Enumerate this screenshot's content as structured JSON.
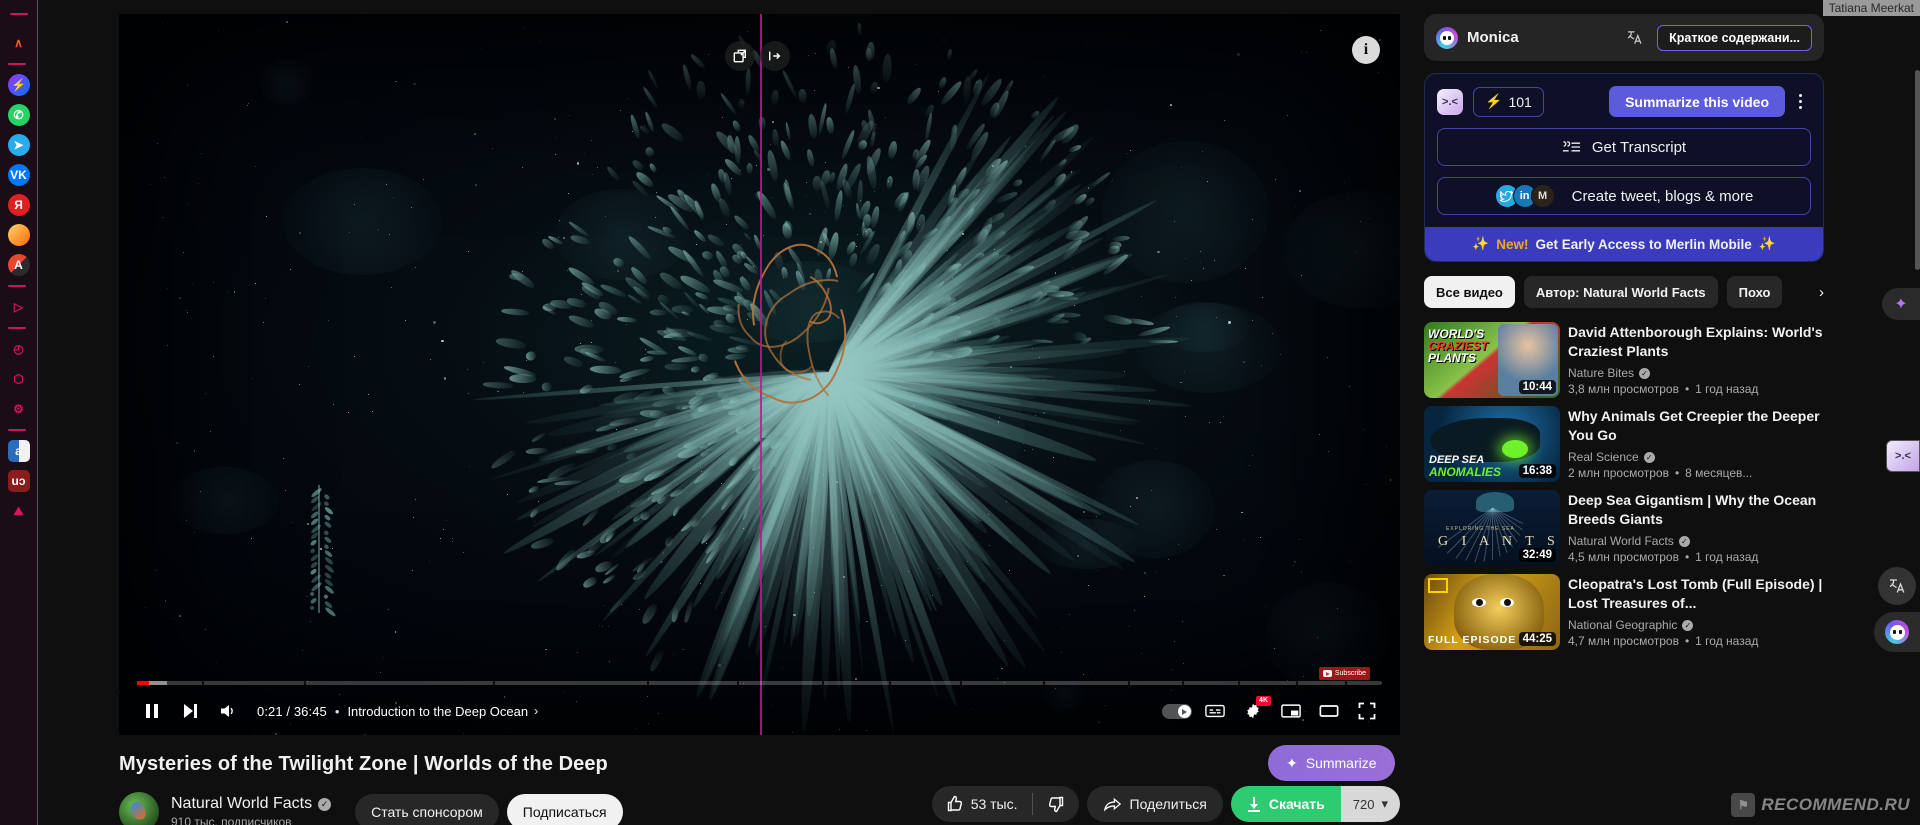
{
  "browser": {
    "tab_title": "Tatiana Meerkat",
    "left_rail_icons": [
      {
        "name": "brave-lion-icon",
        "glyph": "∧",
        "color": "#fb542b",
        "bg": "none"
      },
      {
        "name": "messenger-icon",
        "glyph": "",
        "color": "#fff",
        "bg": "linear-gradient(135deg,#a033ff,#0074f5)"
      },
      {
        "name": "whatsapp-icon",
        "glyph": "",
        "color": "#fff",
        "bg": "#25d366"
      },
      {
        "name": "telegram-icon",
        "glyph": "",
        "color": "#fff",
        "bg": "#2aabee"
      },
      {
        "name": "vk-icon",
        "glyph": "VK",
        "color": "#fff",
        "bg": "#0077ff"
      },
      {
        "name": "yandex-icon",
        "glyph": "Я",
        "color": "#fff",
        "bg": "#e02020"
      },
      {
        "name": "mail-icon",
        "glyph": "",
        "color": "#fff",
        "bg": "linear-gradient(135deg,#ffd26f,#ff6a00)"
      },
      {
        "name": "translate-app-icon",
        "glyph": "A",
        "color": "#fff",
        "bg": "linear-gradient(135deg,#e8452f 50%,#2b2b2b 50%)"
      },
      {
        "name": "video-player-icon",
        "glyph": "▷",
        "color": "#d6145f",
        "bg": "none"
      },
      {
        "name": "history-clock-icon",
        "glyph": "◴",
        "color": "#d6145f",
        "bg": "none"
      },
      {
        "name": "box-3d-icon",
        "glyph": "⬡",
        "color": "#d6145f",
        "bg": "none"
      },
      {
        "name": "settings-gear-icon",
        "glyph": "⚙",
        "color": "#d6145f",
        "bg": "none"
      },
      {
        "name": "amazon-assistant-icon",
        "glyph": "a",
        "color": "#fff",
        "bg": "linear-gradient(90deg,#2a6ebb 50%,#f1f1f1 50%)"
      },
      {
        "name": "ublock-shield-icon",
        "glyph": "uɔ",
        "color": "#fff",
        "bg": "#8a1c1c"
      },
      {
        "name": "image-tool-icon",
        "glyph": "⛰",
        "color": "#d6145f",
        "bg": "none"
      }
    ]
  },
  "player": {
    "top_buttons": [
      {
        "name": "open-popout-icon",
        "glyph": "↗"
      },
      {
        "name": "enter-theater-icon",
        "glyph": "→"
      }
    ],
    "info_button_glyph": "i",
    "yt_watermark_label": "Subscribe",
    "progress": {
      "played_percent": 0.95,
      "buffered_percent": 2.4
    },
    "controls": {
      "pause_label": "Pause",
      "next_label": "Next",
      "volume_label": "Volume",
      "time": "0:21 / 36:45",
      "separator": "•",
      "chapter": "Introduction to the Deep Ocean",
      "chapter_arrow": "›",
      "autoplay_label": "Autoplay",
      "subtitles_label": "Subtitles",
      "settings_label": "Settings",
      "quality_badge": "4K",
      "miniplayer_label": "Miniplayer",
      "theater_label": "Theater mode",
      "fullscreen_label": "Fullscreen"
    }
  },
  "video": {
    "title": "Mysteries of the Twilight Zone | Worlds of the Deep",
    "channel": "Natural World Facts",
    "subscribers": "910 тыс. подписчиков",
    "sponsor_button": "Стать спонсором",
    "subscribe_button": "Подписаться",
    "likes": "53 тыс.",
    "dislike_label": "Dislike",
    "share_button": "Поделиться",
    "download_button": "Скачать",
    "quality_value": "720",
    "quality_caret": "▾",
    "summarize_float": "Summarize",
    "summarize_float_icon": "✦"
  },
  "monica": {
    "name": "Monica",
    "translate_icon_glyph": "文",
    "summary_button": "Краткое содержани..."
  },
  "merlin": {
    "icon_glyph": ">.<",
    "credits": "101",
    "credits_icon": "⚡",
    "summarize_button": "Summarize this video",
    "kebab_label": "More options",
    "get_transcript": "Get Transcript",
    "transcript_icon": "❝",
    "create_content": "Create tweet, blogs & more",
    "socials": [
      {
        "name": "twitter-icon",
        "glyph": "🐦"
      },
      {
        "name": "linkedin-icon",
        "glyph": "in"
      },
      {
        "name": "medium-icon",
        "glyph": "M"
      }
    ],
    "banner_sparkle_left": "✨",
    "banner_new": "New!",
    "banner_text": "Get Early Access to Merlin Mobile",
    "banner_sparkle_right": "✨"
  },
  "chips": [
    {
      "label": "Все видео",
      "active": true
    },
    {
      "label": "Автор: Natural World Facts",
      "active": false
    },
    {
      "label": "Похо",
      "active": false
    }
  ],
  "chips_next_glyph": "›",
  "related_videos": [
    {
      "title": "David Attenborough Explains: World's Craziest Plants",
      "channel": "Nature Bites",
      "views": "3,8 млн просмотров",
      "age": "1 год назад",
      "duration": "10:44",
      "thumb_class": "t1",
      "thumb_text_top": "WORLD'S",
      "thumb_text_mid": "CRAZIEST",
      "thumb_text_bot": "PLANTS"
    },
    {
      "title": "Why Animals Get Creepier the Deeper You Go",
      "channel": "Real Science",
      "views": "2 млн просмотров",
      "age": "8 месяцев...",
      "duration": "16:38",
      "thumb_class": "t2",
      "thumb_text_top": "DEEP SEA",
      "thumb_text_mid": "ANOMALIES",
      "thumb_text_bot": ""
    },
    {
      "title": "Deep Sea Gigantism | Why the Ocean Breeds Giants",
      "channel": "Natural World Facts",
      "views": "4,5 млн просмотров",
      "age": "1 год назад",
      "duration": "32:49",
      "thumb_class": "t3",
      "thumb_text_top": "EXPLORING THE SEA",
      "thumb_text_mid": "G I A N T S",
      "thumb_text_bot": ""
    },
    {
      "title": "Cleopatra's Lost Tomb (Full Episode) | Lost Treasures of...",
      "channel": "National Geographic",
      "views": "4,7 млн просмотров",
      "age": "1 год назад",
      "duration": "44:25",
      "thumb_class": "t4",
      "thumb_text_top": "",
      "thumb_text_mid": "",
      "thumb_text_bot": "FULL EPISODE"
    }
  ],
  "float_buttons": [
    {
      "name": "sparkle-ai-icon",
      "glyph": "✦"
    },
    {
      "name": "merlin-face-icon",
      "glyph": ">.<"
    },
    {
      "name": "translate-circle-icon",
      "glyph": "文"
    },
    {
      "name": "monica-face-icon",
      "glyph": ""
    }
  ],
  "watermark": {
    "text": "RECOMMEND.RU",
    "badge": "⚑"
  },
  "verified_glyph": "✓"
}
